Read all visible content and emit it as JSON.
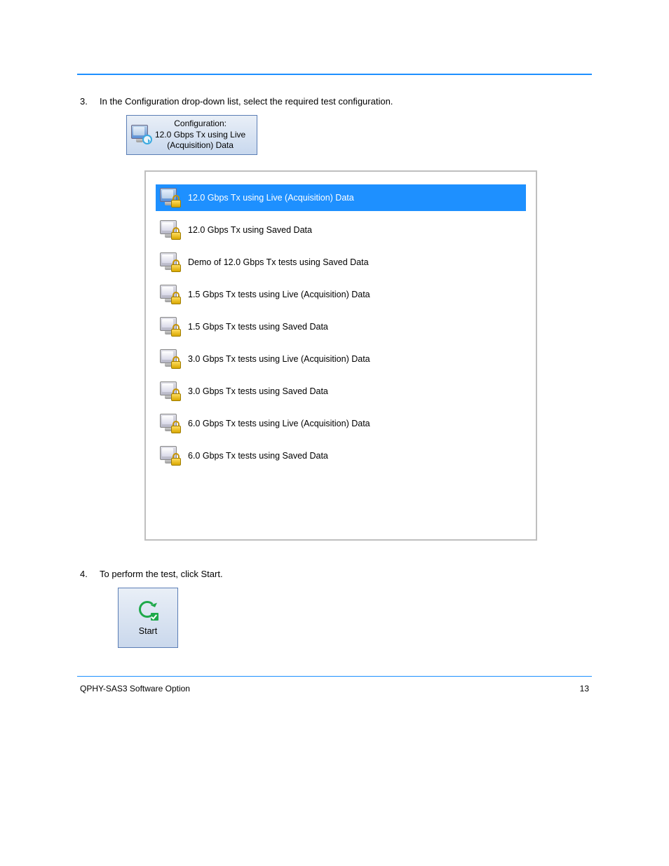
{
  "rule_top": true,
  "step3": {
    "num": "3.",
    "text": "In the Configuration drop-down list, select the required test configuration."
  },
  "config_button": {
    "line1": "Configuration:",
    "line2": "12.0 Gbps Tx using Live",
    "line3": "(Acquisition) Data"
  },
  "config_items": [
    {
      "label": "12.0 Gbps Tx using Live (Acquisition) Data",
      "selected": true
    },
    {
      "label": "12.0 Gbps Tx using Saved Data",
      "selected": false
    },
    {
      "label": "Demo of 12.0 Gbps Tx tests using  Saved Data",
      "selected": false
    },
    {
      "label": "1.5 Gbps Tx tests using Live (Acquisition) Data",
      "selected": false
    },
    {
      "label": "1.5 Gbps Tx tests using Saved Data",
      "selected": false
    },
    {
      "label": "3.0 Gbps Tx tests using Live (Acquisition) Data",
      "selected": false
    },
    {
      "label": "3.0 Gbps Tx tests using Saved Data",
      "selected": false
    },
    {
      "label": "6.0 Gbps Tx tests using Live (Acquisition) Data",
      "selected": false
    },
    {
      "label": "6.0 Gbps Tx tests using Saved Data",
      "selected": false
    }
  ],
  "step4": {
    "num": "4.",
    "text": "To perform the test, click Start."
  },
  "start_label": "Start",
  "footer_left": "QPHY-SAS3 Software Option",
  "footer_right": "13"
}
